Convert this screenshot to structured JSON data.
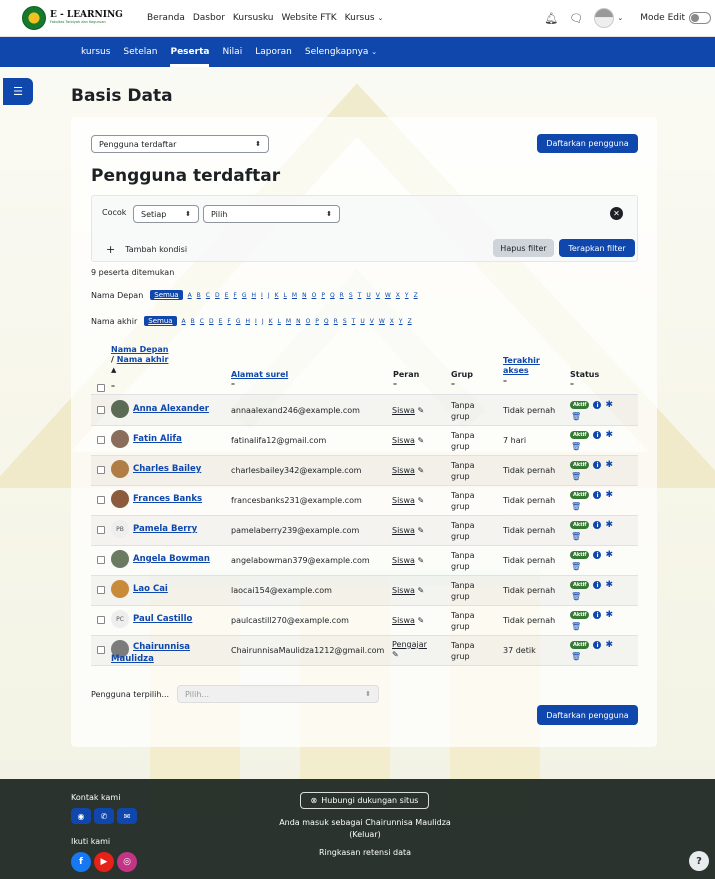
{
  "brand": {
    "title": "E - LEARNING",
    "subtitle": "Fakultas Tarbiyah dan Keguruan"
  },
  "topnav": {
    "items": [
      "Beranda",
      "Dasbor",
      "Kursusku",
      "Website FTK",
      "Kursus"
    ],
    "edit_mode_label": "Mode Edit"
  },
  "secnav": {
    "items": [
      "kursus",
      "Setelan",
      "Peserta",
      "Nilai",
      "Laporan",
      "Selengkapnya"
    ],
    "active": "Peserta"
  },
  "page": {
    "title": "Basis Data"
  },
  "participants": {
    "view_select": "Pengguna terdaftar",
    "enrol_button": "Daftarkan pengguna",
    "heading": "Pengguna terdaftar",
    "filter": {
      "match_label": "Cocok",
      "match_value": "Setiap",
      "condition_placeholder": "Pilih",
      "add_condition": "Tambah kondisi",
      "clear_filters": "Hapus filter",
      "apply_filters": "Terapkan filter"
    },
    "count_text": "9 peserta ditemukan",
    "firstname_label": "Nama Depan",
    "lastname_label": "Nama akhir",
    "all_label": "Semua",
    "letters": [
      "A",
      "B",
      "C",
      "D",
      "E",
      "F",
      "G",
      "H",
      "I",
      "J",
      "K",
      "L",
      "M",
      "N",
      "O",
      "P",
      "Q",
      "R",
      "S",
      "T",
      "U",
      "V",
      "W",
      "X",
      "Y",
      "Z"
    ],
    "columns": {
      "first_name": "Nama Depan",
      "last_name": "Nama akhir",
      "email": "Alamat surel",
      "roles": "Peran",
      "groups": "Grup",
      "last_access": "Terakhir akses",
      "status": "Status"
    },
    "rows": [
      {
        "name": "Anna Alexander",
        "email": "annaalexand246@example.com",
        "role": "Siswa",
        "group": "Tanpa grup",
        "access": "Tidak pernah",
        "avatar": "photo",
        "status": "Aktif"
      },
      {
        "name": "Fatin Alifa",
        "email": "fatinalifa12@gmail.com",
        "role": "Siswa",
        "group": "Tanpa grup",
        "access": "7 hari",
        "avatar": "photo",
        "status": "Aktif"
      },
      {
        "name": "Charles Bailey",
        "email": "charlesbailey342@example.com",
        "role": "Siswa",
        "group": "Tanpa grup",
        "access": "Tidak pernah",
        "avatar": "photo",
        "status": "Aktif"
      },
      {
        "name": "Frances Banks",
        "email": "francesbanks231@example.com",
        "role": "Siswa",
        "group": "Tanpa grup",
        "access": "Tidak pernah",
        "avatar": "photo",
        "status": "Aktif"
      },
      {
        "name": "Pamela Berry",
        "email": "pamelaberry239@example.com",
        "role": "Siswa",
        "group": "Tanpa grup",
        "access": "Tidak pernah",
        "avatar": "PB",
        "status": "Aktif"
      },
      {
        "name": "Angela Bowman",
        "email": "angelabowman379@example.com",
        "role": "Siswa",
        "group": "Tanpa grup",
        "access": "Tidak pernah",
        "avatar": "photo",
        "status": "Aktif"
      },
      {
        "name": "Lao Cai",
        "email": "laocai154@example.com",
        "role": "Siswa",
        "group": "Tanpa grup",
        "access": "Tidak pernah",
        "avatar": "photo",
        "status": "Aktif"
      },
      {
        "name": "Paul Castillo",
        "email": "paulcastill270@example.com",
        "role": "Siswa",
        "group": "Tanpa grup",
        "access": "Tidak pernah",
        "avatar": "PC",
        "status": "Aktif"
      },
      {
        "name_line1": "Chairunnisa",
        "name_line2": "Maulidza",
        "email": "ChairunnisaMaulidza1212@gmail.com",
        "role": "Pengajar",
        "group": "Tanpa grup",
        "access": "37 detik",
        "avatar": "photo",
        "status": "Aktif"
      }
    ],
    "bulk_label": "Pengguna terpilih...",
    "bulk_placeholder": "Pilih..."
  },
  "footer": {
    "contact": "Kontak kami",
    "follow": "Ikuti kami",
    "support": "Hubungi dukungan situs",
    "logged_in_prefix": "Anda masuk sebagai",
    "user": "Chairunnisa Maulidza",
    "logout": "(Keluar)",
    "retention": "Ringkasan retensi data",
    "help": "?"
  }
}
